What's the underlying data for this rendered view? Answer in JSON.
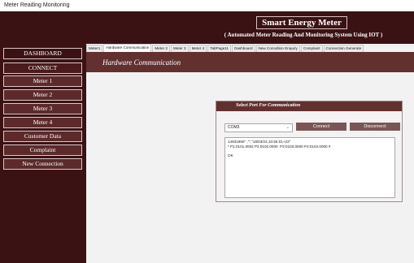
{
  "window": {
    "title": "Meter Reading Monitoring"
  },
  "header": {
    "title": "Smart Energy Meter",
    "subtitle": "( Automated Meter Reading And Monitoring System Using IOT )"
  },
  "sidebar": {
    "items": [
      {
        "label": "DASHBOARD"
      },
      {
        "label": "CONNECT"
      },
      {
        "label": "Meter 1"
      },
      {
        "label": "Meter 2"
      },
      {
        "label": "Meter 3"
      },
      {
        "label": "Meter 4"
      },
      {
        "label": "Customer Data"
      },
      {
        "label": "Complaint"
      },
      {
        "label": "New Connection"
      }
    ]
  },
  "tabs": [
    {
      "label": "Meter1",
      "active": false
    },
    {
      "label": "Hardware Communication",
      "active": true
    },
    {
      "label": "Meter 2",
      "active": false
    },
    {
      "label": "Meter 3",
      "active": false
    },
    {
      "label": "Meter 4",
      "active": false
    },
    {
      "label": "TabPage11",
      "active": false
    },
    {
      "label": "Dashboard",
      "active": false
    },
    {
      "label": "New Conndtion Enquiry",
      "active": false
    },
    {
      "label": "Complaint",
      "active": false
    },
    {
      "label": "Connection Generate",
      "active": false
    }
  ],
  "page": {
    "title": "Hardware Communication"
  },
  "panel": {
    "title": "Select Port For Communication",
    "port_value": "COM3",
    "connect_label": "Connect",
    "disconnect_label": "Disconnect",
    "log_lines": [
      "14931950\" ,\"\",\"18/03/24,10:55:01+22\"",
      "* P1:0101.0002 P2:0102.0000  P3:0103.0000 P4:0104.0000 #",
      "",
      "OK"
    ]
  },
  "colors": {
    "dark_maroon": "#3b1213",
    "maroon": "#62302f",
    "button_maroon": "#7b5555"
  }
}
